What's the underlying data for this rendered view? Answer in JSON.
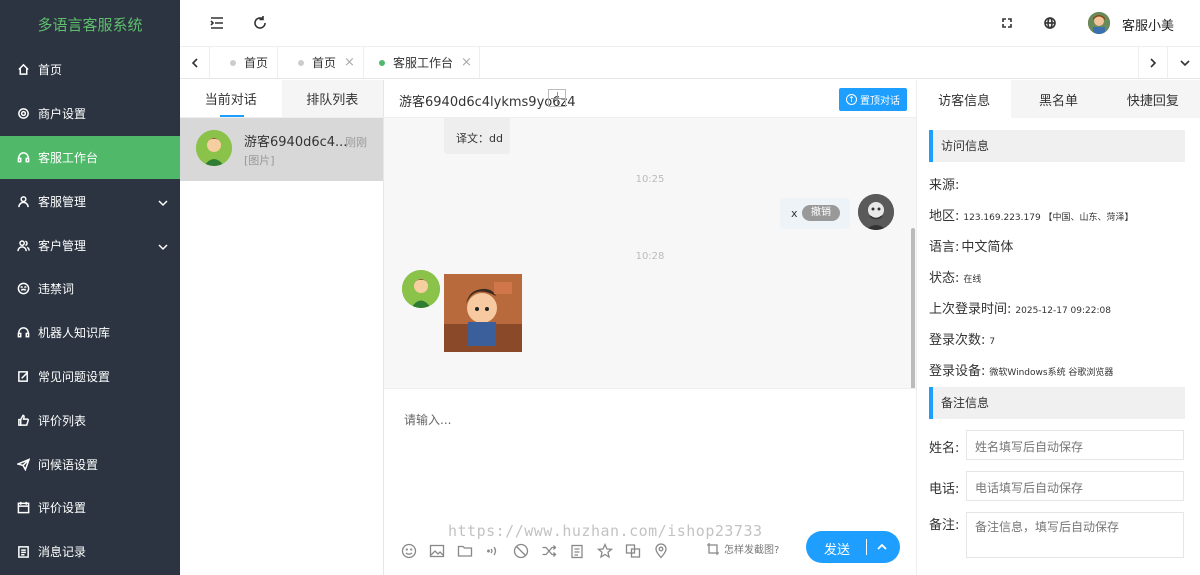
{
  "app": {
    "title": "多语言客服系统"
  },
  "sidebar": {
    "items": [
      {
        "label": "首页",
        "icon": "home-icon",
        "active": false,
        "arrow": false
      },
      {
        "label": "商户设置",
        "icon": "gear-icon",
        "active": false,
        "arrow": false
      },
      {
        "label": "客服工作台",
        "icon": "headset-icon",
        "active": true,
        "arrow": false
      },
      {
        "label": "客服管理",
        "icon": "user-icon",
        "active": false,
        "arrow": true
      },
      {
        "label": "客户管理",
        "icon": "users-icon",
        "active": false,
        "arrow": true
      },
      {
        "label": "违禁词",
        "icon": "smiley-icon",
        "active": false,
        "arrow": false
      },
      {
        "label": "机器人知识库",
        "icon": "robot-icon",
        "active": false,
        "arrow": false
      },
      {
        "label": "常见问题设置",
        "icon": "edit-icon",
        "active": false,
        "arrow": false
      },
      {
        "label": "评价列表",
        "icon": "thumbs-up-icon",
        "active": false,
        "arrow": false
      },
      {
        "label": "问候语设置",
        "icon": "send-icon",
        "active": false,
        "arrow": false
      },
      {
        "label": "评价设置",
        "icon": "calendar-icon",
        "active": false,
        "arrow": false
      },
      {
        "label": "消息记录",
        "icon": "clipboard-icon",
        "active": false,
        "arrow": false
      }
    ]
  },
  "topbar": {
    "user_name": "客服小美"
  },
  "tabs": [
    {
      "label": "首页",
      "closable": false,
      "active": false
    },
    {
      "label": "首页",
      "closable": true,
      "active": false
    },
    {
      "label": "客服工作台",
      "closable": true,
      "active": true
    }
  ],
  "tab_close_glyph": "×",
  "left_panel": {
    "tabs": [
      "当前对话",
      "排队列表"
    ],
    "conversation": {
      "name": "游客6940d6c4...",
      "time": "刚刚",
      "last_message": "[图片]"
    }
  },
  "chat": {
    "title": "游客6940d6c4lykms9yo6z4",
    "pin_label": "置顶对话",
    "messages": {
      "translation": "译文：dd",
      "time1": "10:25",
      "agent_text": "x",
      "recall_label": "撤销",
      "time2": "10:28"
    },
    "input_placeholder": "请输入...",
    "screenshot_tip": "怎样发截图?",
    "send_label": "发送"
  },
  "watermark": "https://www.huzhan.com/ishop23733",
  "right_panel": {
    "tabs": [
      "访客信息",
      "黑名单",
      "快捷回复"
    ],
    "visit_section_title": "访问信息",
    "info": {
      "source_label": "来源:",
      "region_label": "地区:",
      "region_value": "123.169.223.179 【中国、山东、菏泽】",
      "language_label": "语言:",
      "language_value": "中文简体",
      "status_label": "状态:",
      "status_value": "在线",
      "last_login_label": "上次登录时间:",
      "last_login_value": "2025-12-17 09:22:08",
      "login_count_label": "登录次数:",
      "login_count_value": "7",
      "device_label": "登录设备:",
      "device_value": "微软Windows系统 谷歌浏览器"
    },
    "remark_section_title": "备注信息",
    "form": {
      "name_label": "姓名:",
      "name_placeholder": "姓名填写后自动保存",
      "phone_label": "电话:",
      "phone_placeholder": "电话填写后自动保存",
      "remark_label": "备注:",
      "remark_placeholder": "备注信息，填写后自动保存"
    }
  },
  "colors": {
    "sidebar_bg": "#2b3440",
    "active_green": "#4fb969",
    "accent_blue": "#1e9fff",
    "logo_green": "#5fbf6e"
  }
}
